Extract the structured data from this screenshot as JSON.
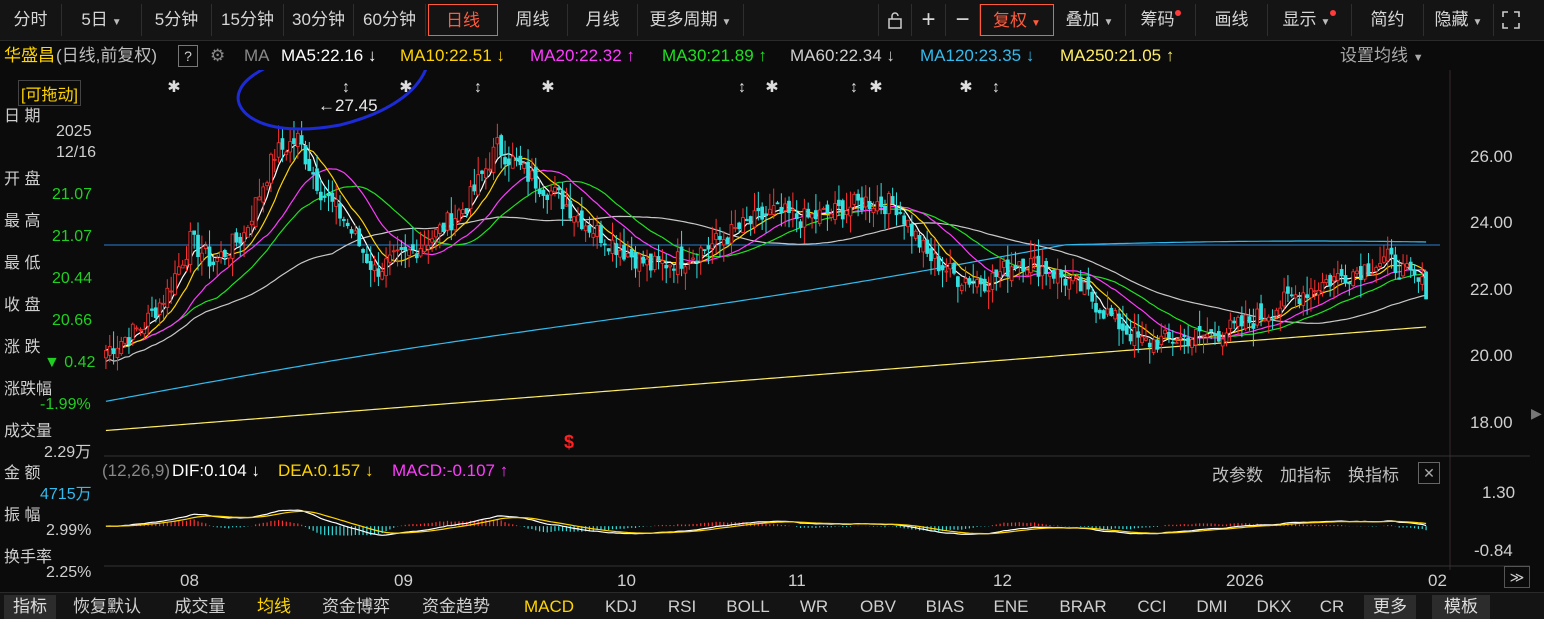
{
  "toolbar": {
    "periods": [
      "分时",
      "5日",
      "5分钟",
      "15分钟",
      "30分钟",
      "60分钟",
      "日线",
      "周线",
      "月线",
      "更多周期"
    ],
    "active_period": "日线",
    "right_buttons": [
      "复权",
      "叠加",
      "筹码",
      "画线",
      "显示",
      "简约",
      "隐藏"
    ],
    "icons": [
      "unlock-icon",
      "zoom-in-icon",
      "zoom-out-icon",
      "fullscreen-icon"
    ]
  },
  "info": {
    "stock_name": "华盛昌",
    "mode": "(日线,前复权)",
    "help": "?",
    "ma_label": "MA",
    "ma_items": [
      {
        "text": "MA5:22.16",
        "arrow": "↓",
        "color": "#ffffff"
      },
      {
        "text": "MA10:22.51",
        "arrow": "↓",
        "color": "#ffd400"
      },
      {
        "text": "MA20:22.32",
        "arrow": "↑",
        "color": "#ff3bff"
      },
      {
        "text": "MA30:21.89",
        "arrow": "↑",
        "color": "#20e020"
      },
      {
        "text": "MA60:22.34",
        "arrow": "↓",
        "color": "#cfcfcf"
      },
      {
        "text": "MA120:23.35",
        "arrow": "↓",
        "color": "#33bbee"
      },
      {
        "text": "MA250:21.05",
        "arrow": "↑",
        "color": "#ffee66"
      }
    ],
    "set_ma": "设置均线"
  },
  "left": {
    "drag": "[可拖动]",
    "date_label": "日 期",
    "year": "2025",
    "date": "12/16",
    "open_label": "开 盘",
    "open": "21.07",
    "high_label": "最 高",
    "high": "21.07",
    "low_label": "最 低",
    "low": "20.44",
    "close_label": "收 盘",
    "close": "20.66",
    "change_label": "涨 跌",
    "change": "▼ 0.42",
    "pct_label": "涨跌幅",
    "pct": "-1.99%",
    "vol_label": "成交量",
    "vol": "2.29万",
    "amt_label": "金 额",
    "amt": "4715万",
    "amp_label": "振 幅",
    "amp": "2.99%",
    "turn_label": "换手率",
    "turn": "2.25%"
  },
  "marker": {
    "high": "27.45"
  },
  "macd": {
    "params": "(12,26,9)",
    "dif": "DIF:0.104",
    "dif_arrow": "↓",
    "dea": "DEA:0.157",
    "dea_arrow": "↓",
    "macd": "MACD:-0.107",
    "macd_arrow": "↑",
    "buttons": [
      "改参数",
      "加指标",
      "换指标"
    ],
    "y_ticks": [
      "1.30",
      "-0.84"
    ]
  },
  "axes": {
    "y_ticks": [
      "26.00",
      "24.00",
      "22.00",
      "20.00",
      "18.00"
    ],
    "x_ticks": [
      "08",
      "09",
      "10",
      "11",
      "12",
      "2026",
      "02"
    ]
  },
  "bottom": {
    "tabs": [
      "指标",
      "恢复默认",
      "成交量",
      "均线",
      "资金博弈",
      "资金趋势",
      "MACD",
      "KDJ",
      "RSI",
      "BOLL",
      "WR",
      "OBV",
      "BIAS",
      "ENE",
      "BRAR",
      "CCI",
      "DMI",
      "DKX",
      "CR",
      "更多",
      "模板"
    ],
    "active": "均线"
  },
  "chart_data": {
    "type": "candlestick",
    "ylim": [
      17.5,
      27.6
    ],
    "macd_ylim": [
      -1.1,
      1.5
    ],
    "price_range": {
      "high": 27.45,
      "low": 20.0
    },
    "last_price": 20.66,
    "ma_latest": {
      "MA5": 22.16,
      "MA10": 22.51,
      "MA20": 22.32,
      "MA30": 21.89,
      "MA60": 22.34,
      "MA120": 23.35,
      "MA250": 21.05
    }
  }
}
